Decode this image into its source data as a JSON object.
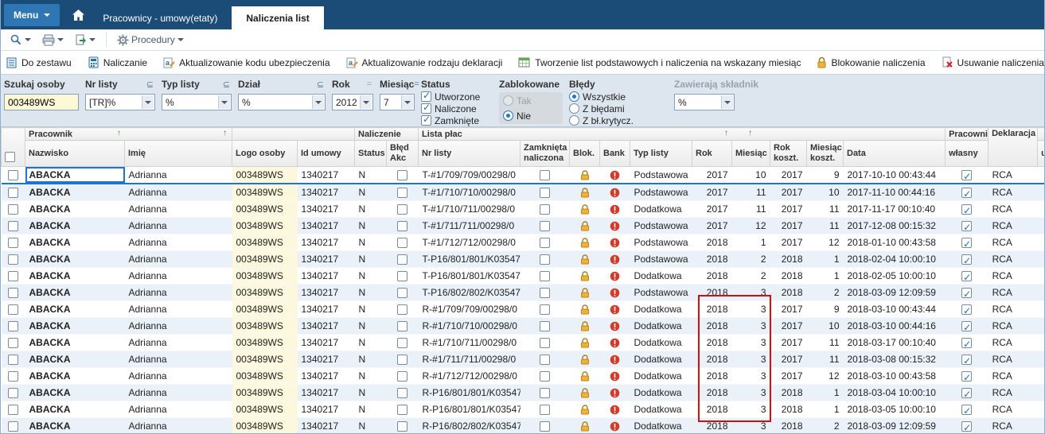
{
  "colors": {
    "topbar": "#1b4b77",
    "menu_button": "#2f76b4",
    "selection": "#1b75d1",
    "highlight_box": "#cc1111",
    "row_alt": "#eaf1f8",
    "logo_column": "#fcf8dd",
    "lock_icon": "#f2b136",
    "bank_icon": "#d43a2a",
    "search_input_bg": "#fdf9d7"
  },
  "topbar": {
    "menu_label": "Menu",
    "home_icon": "home-icon",
    "tabs": [
      {
        "label": "Pracownicy - umowy(etaty)",
        "active": false
      },
      {
        "label": "Naliczenia list",
        "active": true
      }
    ]
  },
  "toolbar": {
    "icons": [
      "search-icon",
      "printer-icon",
      "export-icon",
      "gear-icon"
    ],
    "procedury_label": "Procedury"
  },
  "actions": [
    {
      "label": "Do zestawu",
      "icon": "add-to-set-icon"
    },
    {
      "label": "Naliczanie",
      "icon": "calculate-icon"
    },
    {
      "label": "Aktualizowanie kodu ubezpieczenia",
      "icon": "update-insurance-code-icon"
    },
    {
      "label": "Aktualizowanie rodzaju deklaracji",
      "icon": "update-declaration-type-icon"
    },
    {
      "label": "Tworzenie list podstawowych i naliczenia na wskazany miesiąc",
      "icon": "create-lists-icon"
    },
    {
      "label": "Blokowanie naliczenia",
      "icon": "lock-icon"
    },
    {
      "label": "Usuwanie naliczenia",
      "icon": "delete-icon"
    }
  ],
  "filters": {
    "szukaj_osoby": {
      "label": "Szukaj osoby",
      "value": "003489WS"
    },
    "nr_listy": {
      "label": "Nr listy",
      "operator": "⊆",
      "value": "[TR]%"
    },
    "typ_listy": {
      "label": "Typ listy",
      "operator": "⊆",
      "value": "%"
    },
    "dzial": {
      "label": "Dział",
      "operator": "⊆",
      "value": "%"
    },
    "rok": {
      "label": "Rok",
      "operator": "=",
      "value": "2012",
      "disabled": true
    },
    "miesiac": {
      "label": "Miesiąc",
      "operator": "=",
      "value": "7"
    },
    "status": {
      "label": "Status",
      "options": [
        {
          "label": "Utworzone",
          "checked": true
        },
        {
          "label": "Naliczone",
          "checked": true
        },
        {
          "label": "Zamknięte",
          "checked": true
        }
      ]
    },
    "zablokowane": {
      "label": "Zablokowane",
      "options": [
        {
          "label": "Tak",
          "selected": false,
          "disabled": true
        },
        {
          "label": "Nie",
          "selected": true
        }
      ]
    },
    "bledy": {
      "label": "Błędy",
      "options": [
        {
          "label": "Wszystkie",
          "selected": true
        },
        {
          "label": "Z błędami",
          "selected": false
        },
        {
          "label": "Z bł.krytycz.",
          "selected": false
        }
      ]
    },
    "zawieraja_skladnik": {
      "label": "Zawierają składnik",
      "value": "%",
      "disabled": true
    }
  },
  "table": {
    "groups": {
      "pracownik": "Pracownik",
      "naliczenie": "Naliczenie",
      "lista_plac": "Lista płac",
      "pracownik2": "Pracownik",
      "deklaracja": "Deklaracja"
    },
    "columns": {
      "nazwisko": "Nazwisko",
      "imie": "Imię",
      "logo": "Logo osoby",
      "id_umowy": "Id umowy",
      "status": "Status",
      "bled_akc_1": "Błęd",
      "bled_akc_2": "Akc",
      "nr_listy": "Nr listy",
      "zamknieta_1": "Zamknięta",
      "zamknieta_2": "naliczona",
      "blok": "Blok.",
      "bank": "Bank",
      "typ_listy": "Typ listy",
      "rok": "Rok",
      "miesiac": "Miesiąc",
      "rok_koszt_1": "Rok",
      "rok_koszt_2": "koszt.",
      "miesiac_koszt_1": "Miesiąc",
      "miesiac_koszt_2": "koszt.",
      "data": "Data",
      "wlasny": "własny",
      "u": "u"
    },
    "rows": [
      {
        "selected": true,
        "nazwisko": "ABACKA",
        "imie": "Adrianna",
        "logo": "003489WS",
        "id_umowy": "1340217",
        "status": "N",
        "nr_listy": "T-#1/709/709/00298/0",
        "typ_listy": "Podstawowa",
        "rok": "2017",
        "miesiac": "10",
        "rok_koszt": "2017",
        "miesiac_koszt": "9",
        "data": "2017-10-10 00:43:44",
        "deklaracja": "RCA"
      },
      {
        "nazwisko": "ABACKA",
        "imie": "Adrianna",
        "logo": "003489WS",
        "id_umowy": "1340217",
        "status": "N",
        "nr_listy": "T-#1/710/710/00298/0",
        "typ_listy": "Podstawowa",
        "rok": "2017",
        "miesiac": "11",
        "rok_koszt": "2017",
        "miesiac_koszt": "10",
        "data": "2017-11-10 00:44:16",
        "deklaracja": "RCA"
      },
      {
        "nazwisko": "ABACKA",
        "imie": "Adrianna",
        "logo": "003489WS",
        "id_umowy": "1340217",
        "status": "N",
        "nr_listy": "T-#1/710/711/00298/0",
        "typ_listy": "Dodatkowa",
        "rok": "2017",
        "miesiac": "11",
        "rok_koszt": "2017",
        "miesiac_koszt": "11",
        "data": "2017-11-17 00:10:40",
        "deklaracja": "RCA"
      },
      {
        "nazwisko": "ABACKA",
        "imie": "Adrianna",
        "logo": "003489WS",
        "id_umowy": "1340217",
        "status": "N",
        "nr_listy": "T-#1/711/711/00298/0",
        "typ_listy": "Podstawowa",
        "rok": "2017",
        "miesiac": "12",
        "rok_koszt": "2017",
        "miesiac_koszt": "11",
        "data": "2017-12-08 00:15:32",
        "deklaracja": "RCA"
      },
      {
        "nazwisko": "ABACKA",
        "imie": "Adrianna",
        "logo": "003489WS",
        "id_umowy": "1340217",
        "status": "N",
        "nr_listy": "T-#1/712/712/00298/0",
        "typ_listy": "Podstawowa",
        "rok": "2018",
        "miesiac": "1",
        "rok_koszt": "2017",
        "miesiac_koszt": "12",
        "data": "2018-01-10 00:43:58",
        "deklaracja": "RCA"
      },
      {
        "nazwisko": "ABACKA",
        "imie": "Adrianna",
        "logo": "003489WS",
        "id_umowy": "1340217",
        "status": "N",
        "nr_listy": "T-P16/801/801/K03547",
        "typ_listy": "Podstawowa",
        "rok": "2018",
        "miesiac": "2",
        "rok_koszt": "2018",
        "miesiac_koszt": "1",
        "data": "2018-02-04 10:00:10",
        "deklaracja": "RCA"
      },
      {
        "nazwisko": "ABACKA",
        "imie": "Adrianna",
        "logo": "003489WS",
        "id_umowy": "1340217",
        "status": "N",
        "nr_listy": "T-P16/801/801/K03547",
        "typ_listy": "Dodatkowa",
        "rok": "2018",
        "miesiac": "2",
        "rok_koszt": "2018",
        "miesiac_koszt": "1",
        "data": "2018-02-05 10:00:10",
        "deklaracja": "RCA"
      },
      {
        "nazwisko": "ABACKA",
        "imie": "Adrianna",
        "logo": "003489WS",
        "id_umowy": "1340217",
        "status": "N",
        "nr_listy": "T-P16/802/802/K03547",
        "typ_listy": "Podstawowa",
        "rok": "2018",
        "miesiac": "3",
        "rok_koszt": "2018",
        "miesiac_koszt": "2",
        "data": "2018-03-09 12:09:59",
        "deklaracja": "RCA"
      },
      {
        "nazwisko": "ABACKA",
        "imie": "Adrianna",
        "logo": "003489WS",
        "id_umowy": "1340217",
        "status": "N",
        "nr_listy": "R-#1/709/709/00298/0",
        "typ_listy": "Dodatkowa",
        "rok": "2018",
        "miesiac": "3",
        "rok_koszt": "2017",
        "miesiac_koszt": "9",
        "data": "2018-03-10 00:43:44",
        "deklaracja": "RCA"
      },
      {
        "nazwisko": "ABACKA",
        "imie": "Adrianna",
        "logo": "003489WS",
        "id_umowy": "1340217",
        "status": "N",
        "nr_listy": "R-#1/710/710/00298/0",
        "typ_listy": "Dodatkowa",
        "rok": "2018",
        "miesiac": "3",
        "rok_koszt": "2017",
        "miesiac_koszt": "10",
        "data": "2018-03-10 00:44:16",
        "deklaracja": "RCA"
      },
      {
        "nazwisko": "ABACKA",
        "imie": "Adrianna",
        "logo": "003489WS",
        "id_umowy": "1340217",
        "status": "N",
        "nr_listy": "R-#1/710/711/00298/0",
        "typ_listy": "Dodatkowa",
        "rok": "2018",
        "miesiac": "3",
        "rok_koszt": "2017",
        "miesiac_koszt": "11",
        "data": "2018-03-17 00:10:40",
        "deklaracja": "RCA"
      },
      {
        "nazwisko": "ABACKA",
        "imie": "Adrianna",
        "logo": "003489WS",
        "id_umowy": "1340217",
        "status": "N",
        "nr_listy": "R-#1/711/711/00298/0",
        "typ_listy": "Dodatkowa",
        "rok": "2018",
        "miesiac": "3",
        "rok_koszt": "2017",
        "miesiac_koszt": "11",
        "data": "2018-03-08 00:15:32",
        "deklaracja": "RCA"
      },
      {
        "nazwisko": "ABACKA",
        "imie": "Adrianna",
        "logo": "003489WS",
        "id_umowy": "1340217",
        "status": "N",
        "nr_listy": "R-#1/712/712/00298/0",
        "typ_listy": "Dodatkowa",
        "rok": "2018",
        "miesiac": "3",
        "rok_koszt": "2017",
        "miesiac_koszt": "12",
        "data": "2018-03-10 00:43:58",
        "deklaracja": "RCA"
      },
      {
        "nazwisko": "ABACKA",
        "imie": "Adrianna",
        "logo": "003489WS",
        "id_umowy": "1340217",
        "status": "N",
        "nr_listy": "R-P16/801/801/K03547",
        "typ_listy": "Dodatkowa",
        "rok": "2018",
        "miesiac": "3",
        "rok_koszt": "2018",
        "miesiac_koszt": "1",
        "data": "2018-03-04 10:00:10",
        "deklaracja": "RCA"
      },
      {
        "nazwisko": "ABACKA",
        "imie": "Adrianna",
        "logo": "003489WS",
        "id_umowy": "1340217",
        "status": "N",
        "nr_listy": "R-P16/801/801/K03547",
        "typ_listy": "Dodatkowa",
        "rok": "2018",
        "miesiac": "3",
        "rok_koszt": "2018",
        "miesiac_koszt": "1",
        "data": "2018-03-05 10:00:10",
        "deklaracja": "RCA"
      },
      {
        "nazwisko": "ABACKA",
        "imie": "Adrianna",
        "logo": "003489WS",
        "id_umowy": "1340217",
        "status": "N",
        "nr_listy": "R-P16/802/802/K03547",
        "typ_listy": "Dodatkowa",
        "rok": "2018",
        "miesiac": "3",
        "rok_koszt": "2018",
        "miesiac_koszt": "2",
        "data": "2018-03-09 12:09:59",
        "deklaracja": "RCA"
      }
    ]
  }
}
